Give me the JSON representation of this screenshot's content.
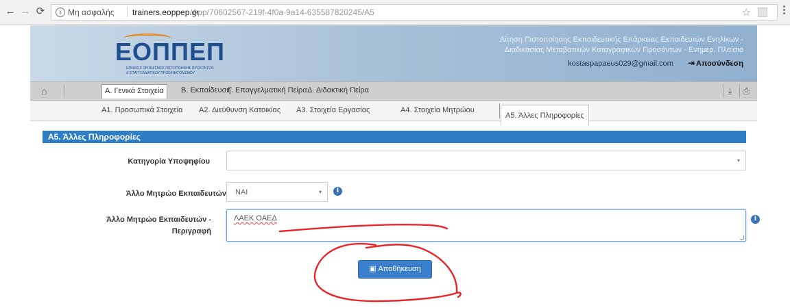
{
  "browser": {
    "secure_label": "Μη ασφαλής",
    "url_host": "trainers.eoppep.gr",
    "url_path": "/App/70602567-219f-4f0a-9a14-635587820245/A5"
  },
  "header": {
    "logo_text": "ΕΟΠΠΕΠ",
    "logo_sub1": "ΕΘΝΙΚΟΣ ΟΡΓΑΝΙΣΜΟΣ ΠΙΣΤΟΠΟΙΗΣΗΣ ΠΡΟΣΟΝΤΩΝ",
    "logo_sub2": "& ΕΠΑΓΓΕΛΜΑΤΙΚΟΥ ΠΡΟΣΑΝΑΤΟΛΙΣΜΟΥ",
    "title_line1": "Αίτηση Πιστοποίησης Εκπαιδευτικής Επάρκειας Εκπαιδευτών Ενηλίκων -",
    "title_line2": "Διαδικασίας Μεταβατικών Καταγραφικών Προσόντων - Ενημερ. Πλαίσιο",
    "user_email": "kostaspapaeus029@gmail.com",
    "logout": "Αποσύνδεση"
  },
  "tabs": [
    {
      "label": "Α. Γενικά Στοιχεία",
      "active": true
    },
    {
      "label": "Β. Εκπαίδευση",
      "active": false
    },
    {
      "label": "Γ. Επαγγελματική Πείρα",
      "active": false
    },
    {
      "label": "Δ. Διδακτική Πείρα",
      "active": false
    }
  ],
  "subtabs": [
    {
      "label": "Α1. Προσωπικά Στοιχεία"
    },
    {
      "label": "Α2. Διεύθυνση Κατοικίας"
    },
    {
      "label": "Α3. Στοιχεία Εργασίας"
    },
    {
      "label": "Α4. Στοιχεία Μητρώου"
    }
  ],
  "active_subtab": "Α5. Άλλες Πληροφορίες",
  "section_title": "Α5. Άλλες Πληροφορίες",
  "form": {
    "category_label": "Κατηγορία Υποψηφίου",
    "category_value": "",
    "other_registry_label": "Άλλο Μητρώο Εκπαιδευτών",
    "other_registry_value": "ΝΑΙ",
    "description_label_line1": "Άλλο Μητρώο Εκπαιδευτών -",
    "description_label_line2": "Περιγραφή",
    "description_value": "ΛΑΕΚ ΟΑΕΔ",
    "save_label": "Αποθήκευση"
  },
  "colors": {
    "section_header": "#2d7dc4",
    "save_button": "#3a7fcc",
    "annotation": "#e8262a"
  }
}
